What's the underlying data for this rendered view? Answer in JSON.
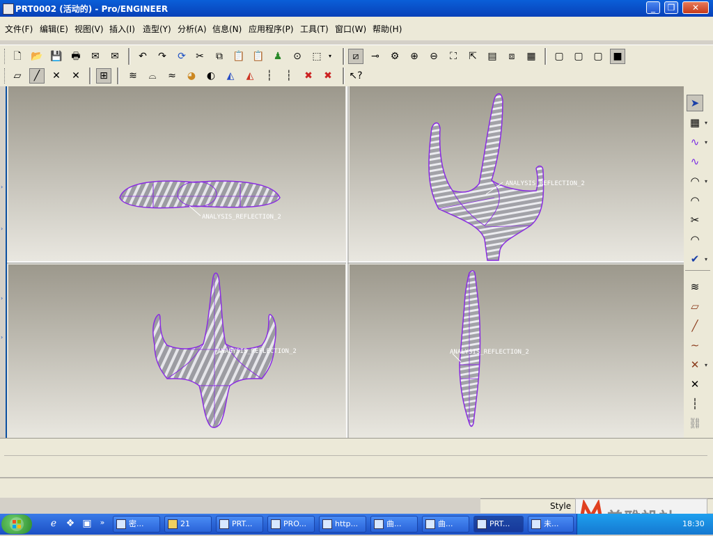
{
  "window": {
    "title": "PRT0002 (活动的) - Pro/ENGINEER"
  },
  "menu": [
    "文件(F)",
    "编辑(E)",
    "视图(V)",
    "插入(I)",
    "造型(Y)",
    "分析(A)",
    "信息(N)",
    "应用程序(P)",
    "工具(T)",
    "窗口(W)",
    "帮助(H)"
  ],
  "viewports": {
    "annotation": "ANALYSIS_REFLECTION_2"
  },
  "status": {
    "style_label": "Style"
  },
  "taskbar": {
    "tasks": [
      "密...",
      "21",
      "PRT...",
      "PRO...",
      "http...",
      "曲...",
      "曲...",
      "PRT...",
      "未..."
    ],
    "clock": "18:30"
  },
  "watermark": {
    "text": "美雅設計"
  },
  "colors": {
    "title_blue": "#0840b8",
    "surface_gray": "#9c9ca2",
    "edge_purple": "#8a2be2",
    "taskbar_blue": "#245edc"
  }
}
